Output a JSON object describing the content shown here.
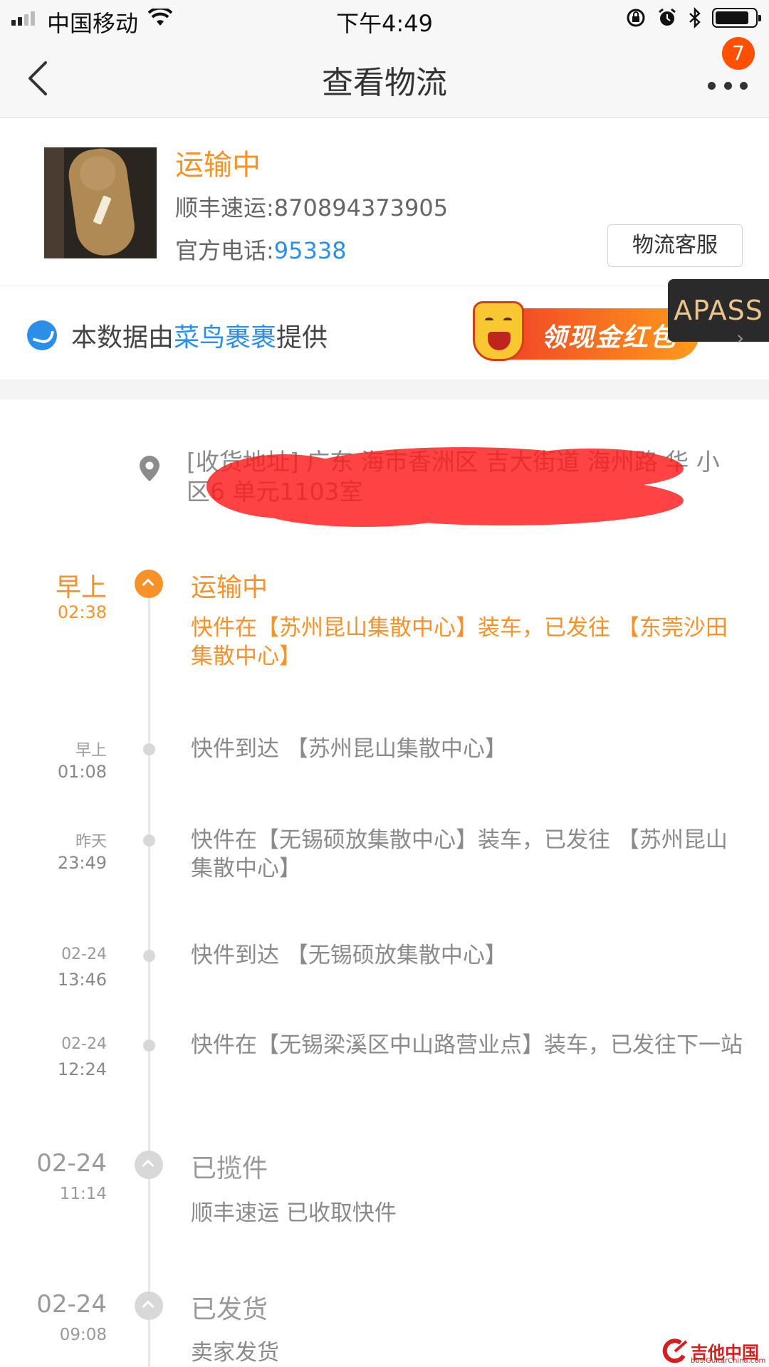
{
  "status_bar": {
    "carrier": "中国移动",
    "time": "下午4:49",
    "battery_level": 0.85
  },
  "nav": {
    "title": "查看物流",
    "badge_count": "7"
  },
  "package": {
    "status": "运输中",
    "carrier_label": "顺丰速运:",
    "tracking_number": "870894373905",
    "phone_label": "官方电话:",
    "phone": "95338",
    "service_button": "物流客服"
  },
  "provider": {
    "prefix": "本数据由",
    "brand": "菜鸟裹裹",
    "suffix": "提供",
    "promo": "领现金红包",
    "apass": "APASS"
  },
  "address": {
    "text": "[收货地址] 广东 海市香洲区 吉大街道 海州路 华 小区6 单元1103室"
  },
  "timeline": [
    {
      "date_main": "早上",
      "date_sub": "02:38",
      "title": "运输中",
      "text": "快件在【苏州昆山集散中心】装车，已发往 【东莞沙田集散中心】",
      "kind": "active"
    },
    {
      "date_main": "早上",
      "date_sub": "01:08",
      "text": "快件到达 【苏州昆山集散中心】",
      "kind": "small"
    },
    {
      "date_main": "昨天",
      "date_sub": "23:49",
      "text": "快件在【无锡硕放集散中心】装车，已发往 【苏州昆山集散中心】",
      "kind": "small"
    },
    {
      "date_main": "02-24",
      "date_sub": "13:46",
      "text": "快件到达 【无锡硕放集散中心】",
      "kind": "small"
    },
    {
      "date_main": "02-24",
      "date_sub": "12:24",
      "text": "快件在【无锡梁溪区中山路营业点】装车，已发往下一站",
      "kind": "small"
    },
    {
      "date_main": "02-24",
      "date_sub": "11:14",
      "title": "已揽件",
      "text": "顺丰速运 已收取快件",
      "kind": "big"
    },
    {
      "date_main": "02-24",
      "date_sub": "09:08",
      "title": "已发货",
      "text": "卖家发货",
      "kind": "big"
    }
  ],
  "watermark": {
    "text": "吉他中国",
    "sub": "bbs.GuitarChina.com"
  }
}
